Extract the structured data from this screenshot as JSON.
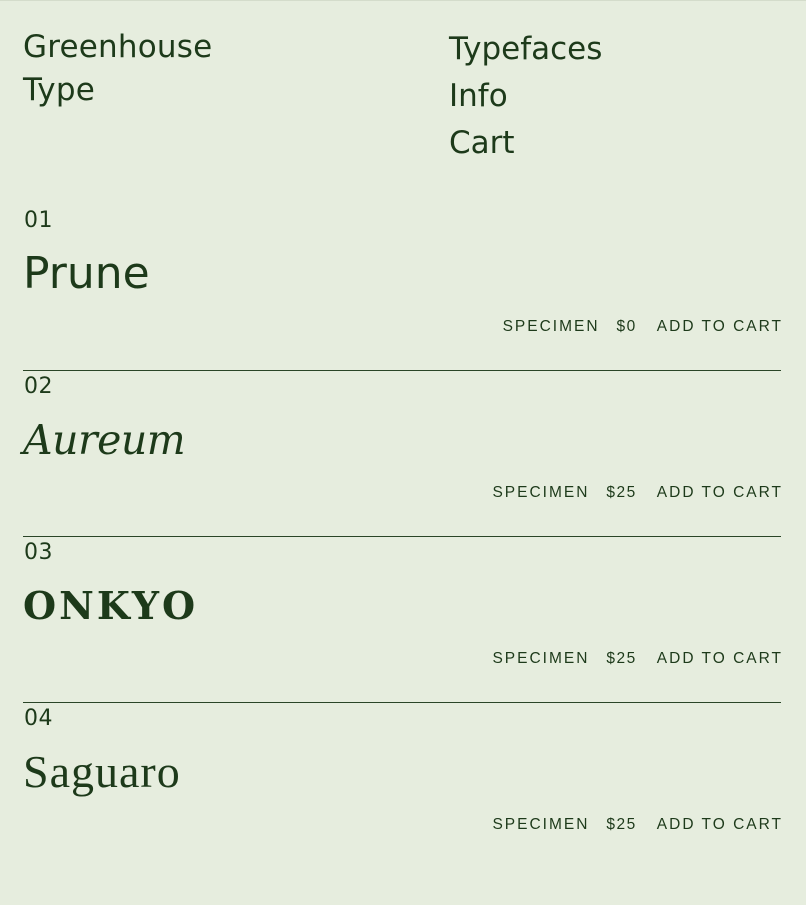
{
  "brand": {
    "line1": "Greenhouse",
    "line2": "Type"
  },
  "nav": {
    "items": [
      {
        "label": "Typefaces"
      },
      {
        "label": "Info"
      },
      {
        "label": "Cart"
      }
    ]
  },
  "typefaces": [
    {
      "number": "01",
      "name": "Prune",
      "specimen_label": "SPECIMEN",
      "price": "$0",
      "cart_label": "ADD TO CART"
    },
    {
      "number": "02",
      "name": "Aureum",
      "specimen_label": "SPECIMEN",
      "price": "$25",
      "cart_label": "ADD TO CART"
    },
    {
      "number": "03",
      "name": "ONKYO",
      "specimen_label": "SPECIMEN",
      "price": "$25",
      "cart_label": "ADD TO CART"
    },
    {
      "number": "04",
      "name": "Saguaro",
      "specimen_label": "SPECIMEN",
      "price": "$25",
      "cart_label": "ADD TO CART"
    }
  ],
  "colors": {
    "background": "#e6edde",
    "text": "#1d3a1a",
    "divider": "#2a4527"
  }
}
